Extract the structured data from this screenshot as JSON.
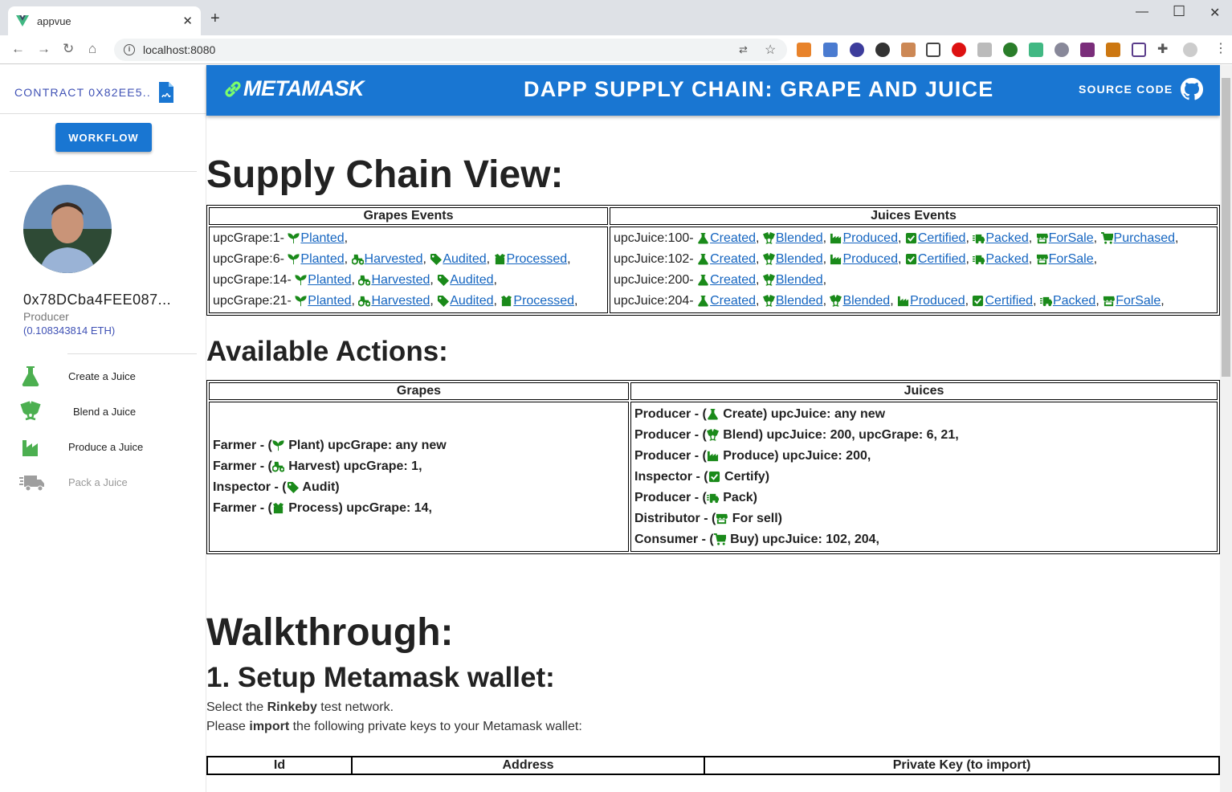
{
  "browser": {
    "tab_title": "appvue",
    "url": "localhost:8080"
  },
  "sidebar": {
    "contract": "CONTRACT 0X82EE5..",
    "workflow": "WORKFLOW",
    "address": "0x78DCba4FEE087...",
    "role": "Producer",
    "balance": "(0.108343814 ETH)",
    "menu": [
      {
        "label": "Create a Juice",
        "icon": "flask-icon"
      },
      {
        "label": "Blend a Juice",
        "icon": "cheers-icon"
      },
      {
        "label": "Produce a Juice",
        "icon": "factory-icon"
      },
      {
        "label": "Pack a Juice",
        "icon": "truck-icon"
      }
    ]
  },
  "header": {
    "brand": "METAMASK",
    "title": "DAPP SUPPLY CHAIN: GRAPE AND JUICE",
    "source": "SOURCE CODE"
  },
  "supply": {
    "title": "Supply Chain View:",
    "grapes_header": "Grapes Events",
    "juices_header": "Juices Events",
    "grapes": [
      {
        "label": "upcGrape:1- ",
        "events": [
          [
            "sprout",
            "Planted"
          ]
        ]
      },
      {
        "label": "upcGrape:6- ",
        "events": [
          [
            "sprout",
            "Planted"
          ],
          [
            "tractor",
            "Harvested"
          ],
          [
            "tag",
            "Audited"
          ],
          [
            "box",
            "Processed"
          ]
        ]
      },
      {
        "label": "upcGrape:14- ",
        "events": [
          [
            "sprout",
            "Planted"
          ],
          [
            "tractor",
            "Harvested"
          ],
          [
            "tag",
            "Audited"
          ]
        ]
      },
      {
        "label": "upcGrape:21- ",
        "events": [
          [
            "sprout",
            "Planted"
          ],
          [
            "tractor",
            "Harvested"
          ],
          [
            "tag",
            "Audited"
          ],
          [
            "box",
            "Processed"
          ]
        ]
      }
    ],
    "juices": [
      {
        "label": "upcJuice:100- ",
        "events": [
          [
            "flask",
            "Created"
          ],
          [
            "cheers",
            "Blended"
          ],
          [
            "factory",
            "Produced"
          ],
          [
            "check",
            "Certified"
          ],
          [
            "truck",
            "Packed"
          ],
          [
            "store",
            "ForSale"
          ],
          [
            "cart",
            "Purchased"
          ]
        ]
      },
      {
        "label": "upcJuice:102- ",
        "events": [
          [
            "flask",
            "Created"
          ],
          [
            "cheers",
            "Blended"
          ],
          [
            "factory",
            "Produced"
          ],
          [
            "check",
            "Certified"
          ],
          [
            "truck",
            "Packed"
          ],
          [
            "store",
            "ForSale"
          ]
        ]
      },
      {
        "label": "upcJuice:200- ",
        "events": [
          [
            "flask",
            "Created"
          ],
          [
            "cheers",
            "Blended"
          ]
        ]
      },
      {
        "label": "upcJuice:204- ",
        "events": [
          [
            "flask",
            "Created"
          ],
          [
            "cheers",
            "Blended"
          ],
          [
            "cheers",
            "Blended"
          ],
          [
            "factory",
            "Produced"
          ],
          [
            "check",
            "Certified"
          ],
          [
            "truck",
            "Packed"
          ],
          [
            "store",
            "ForSale"
          ]
        ]
      }
    ]
  },
  "actions": {
    "title": "Available Actions:",
    "grapes_header": "Grapes",
    "juices_header": "Juices",
    "grapes": [
      {
        "pre": "Farmer - (",
        "icon": "sprout",
        "post": " Plant) upcGrape: any new"
      },
      {
        "pre": "Farmer - (",
        "icon": "tractor",
        "post": " Harvest) upcGrape: 1,"
      },
      {
        "pre": "Inspector - (",
        "icon": "tag",
        "post": " Audit)"
      },
      {
        "pre": "Farmer - (",
        "icon": "box",
        "post": " Process) upcGrape: 14,"
      }
    ],
    "juices": [
      {
        "pre": "Producer - (",
        "icon": "flask",
        "post": " Create) upcJuice: any new"
      },
      {
        "pre": "Producer - (",
        "icon": "cheers",
        "post": " Blend) upcJuice: 200, upcGrape: 6, 21,"
      },
      {
        "pre": "Producer - (",
        "icon": "factory",
        "post": " Produce) upcJuice: 200,"
      },
      {
        "pre": "Inspector - (",
        "icon": "check",
        "post": " Certify)"
      },
      {
        "pre": "Producer - (",
        "icon": "truck",
        "post": " Pack)"
      },
      {
        "pre": "Distributor - (",
        "icon": "store",
        "post": " For sell)"
      },
      {
        "pre": "Consumer - (",
        "icon": "cart",
        "post": " Buy) upcJuice: 102, 204,"
      }
    ]
  },
  "walk": {
    "title": "Walkthrough:",
    "step1": "1. Setup Metamask wallet:",
    "line1_a": "Select the ",
    "line1_b": "Rinkeby",
    "line1_c": " test network.",
    "line2_a": "Please ",
    "line2_b": "import",
    "line2_c": " the following private keys to your Metamask wallet:",
    "cols": [
      "Id",
      "Address",
      "Private Key (to import)"
    ]
  },
  "colors": {
    "accent": "#1976d2",
    "icon_green": "#1a8a1a",
    "link": "#1565c0"
  }
}
